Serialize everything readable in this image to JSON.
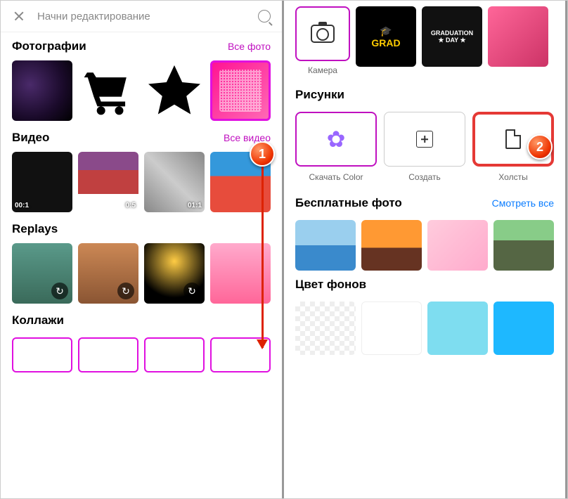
{
  "left": {
    "search_placeholder": "Начни редактирование",
    "photos": {
      "title": "Фотографии",
      "link": "Все фото"
    },
    "videos": {
      "title": "Видео",
      "link": "Все видео",
      "d1": "00:1",
      "d2": "0:5",
      "d3": "01:1"
    },
    "replays": {
      "title": "Replays"
    },
    "collages": {
      "title": "Коллажи"
    },
    "marker1": "1"
  },
  "right": {
    "camera_label": "Камера",
    "grad1a": "🎓",
    "grad1b": "GRAD",
    "grad2a": "GRADUATION",
    "grad2b": "★ DAY ★",
    "drawings": {
      "title": "Рисунки",
      "download": "Скачать Color",
      "create": "Создать",
      "canvas": "Холсты"
    },
    "free": {
      "title": "Бесплатные фото",
      "link": "Смотреть все"
    },
    "bgcolor": {
      "title": "Цвет фонов"
    },
    "marker2": "2"
  }
}
